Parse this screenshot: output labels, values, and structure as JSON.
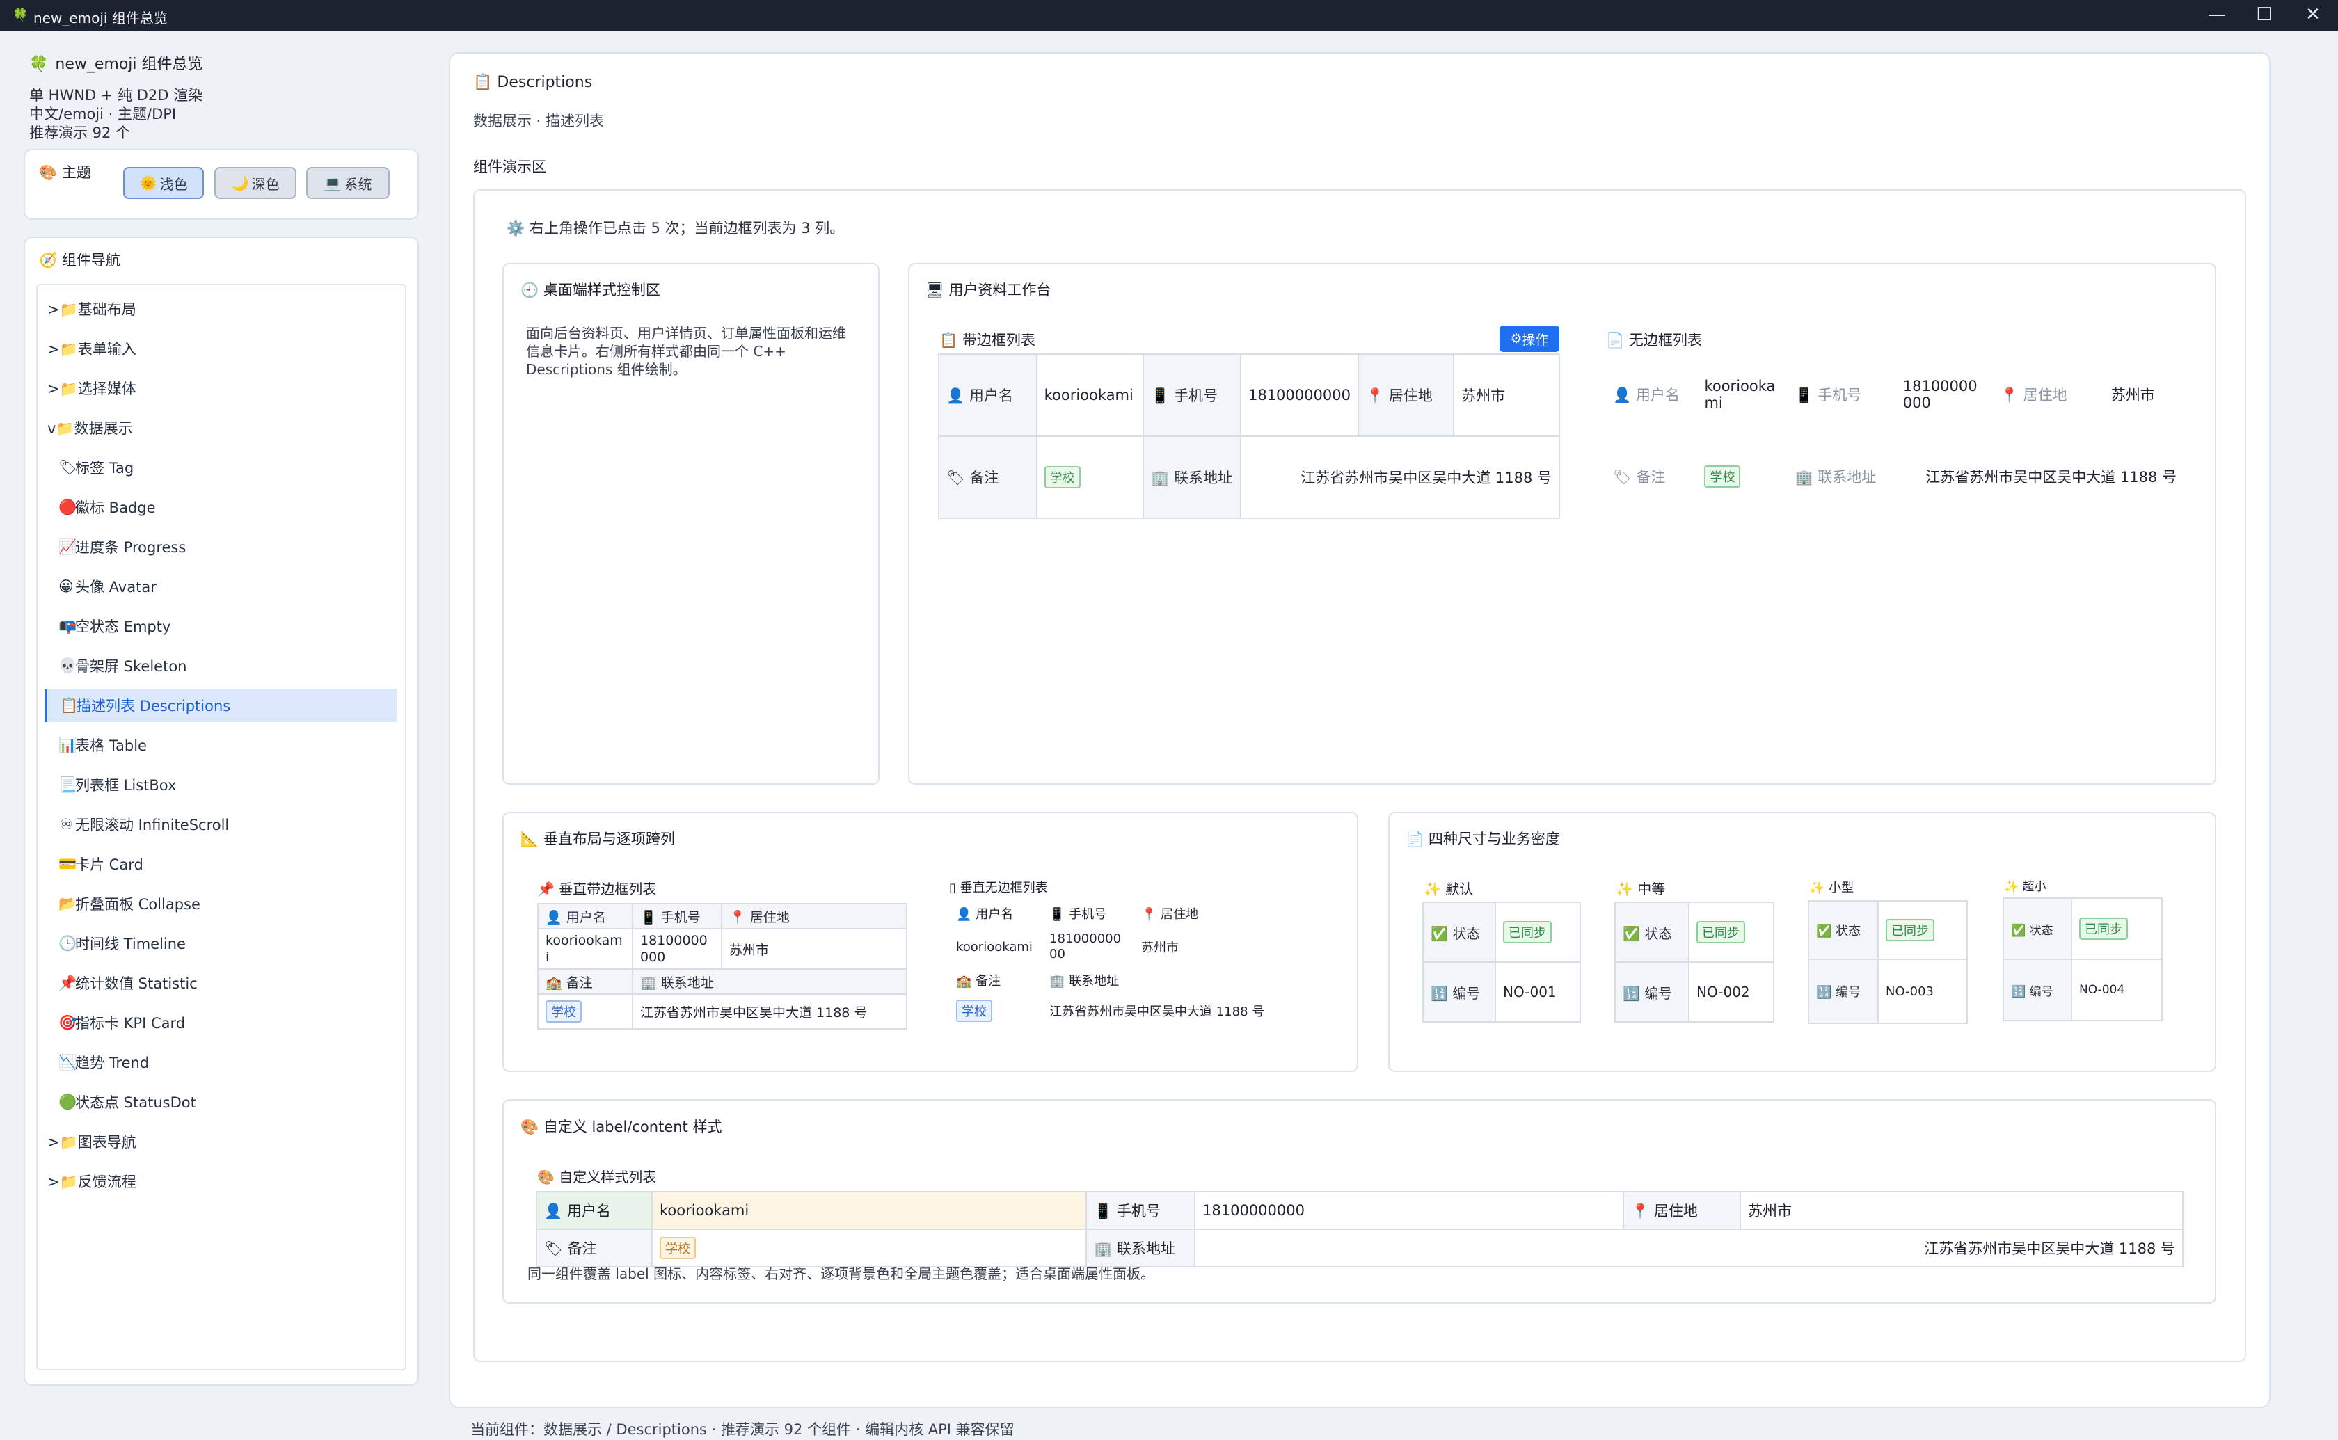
{
  "window": {
    "title": "new_emoji 组件总览",
    "icon": "clover-icon",
    "controls": {
      "minimize": "—",
      "maximize": "☐",
      "close": "✕"
    }
  },
  "sidebar": {
    "app_title": "new_emoji 组件总览",
    "desc_lines": [
      "单 HWND + 纯 D2D 渲染",
      "中文/emoji · 主题/DPI",
      "推荐演示 92 个"
    ],
    "theme": {
      "title": "主题",
      "buttons": [
        "浅色",
        "深色",
        "系统"
      ],
      "selected": "浅色"
    },
    "nav": {
      "title": "组件导航",
      "groups": [
        {
          "label": ">📁基础布局"
        },
        {
          "label": ">📁表单输入"
        },
        {
          "label": ">📁选择媒体"
        },
        {
          "label": "v📁数据展示"
        }
      ],
      "children": [
        {
          "icon": "🏷",
          "label": "标签 Tag"
        },
        {
          "icon": "🔴",
          "label": "徽标 Badge"
        },
        {
          "icon": "📈",
          "label": "进度条 Progress"
        },
        {
          "icon": "😀",
          "label": "头像 Avatar"
        },
        {
          "icon": "📭",
          "label": "空状态 Empty"
        },
        {
          "icon": "💀",
          "label": "骨架屏 Skeleton"
        },
        {
          "icon": "📋",
          "label": "描述列表 Descriptions"
        },
        {
          "icon": "📊",
          "label": "表格 Table"
        },
        {
          "icon": "📃",
          "label": "列表框 ListBox"
        },
        {
          "icon": "♾",
          "label": "无限滚动 InfiniteScroll"
        },
        {
          "icon": "💳",
          "label": "卡片 Card"
        },
        {
          "icon": "📂",
          "label": "折叠面板 Collapse"
        },
        {
          "icon": "🕒",
          "label": "时间线 Timeline"
        },
        {
          "icon": "📌",
          "label": "统计数值 Statistic"
        },
        {
          "icon": "🎯",
          "label": "指标卡 KPI Card"
        },
        {
          "icon": "📉",
          "label": "趋势 Trend"
        },
        {
          "icon": "🟢",
          "label": "状态点 StatusDot"
        }
      ],
      "tail_groups": [
        {
          "label": ">📁图表导航"
        },
        {
          "label": ">📁反馈流程"
        }
      ],
      "active": "描述列表 Descriptions"
    }
  },
  "main": {
    "title": "Descriptions",
    "subtitle": "数据展示 · 描述列表",
    "demo_label": "组件演示区",
    "status": "右上角操作已点击 5 次；当前边框列表为 3 列。",
    "console": {
      "title": "桌面端样式控制区",
      "text": "面向后台资料页、用户详情页、订单属性面板和运维信息卡片。右侧所有样式都由同一个 C++ Descriptions 组件绘制。"
    },
    "workbench": {
      "title": "用户资料工作台",
      "bordered_title": "带边框列表",
      "borderless_title": "无边框列表",
      "op_button": "操作"
    },
    "fields": {
      "username_label": "用户名",
      "username": "kooriookami",
      "phone_label": "手机号",
      "phone": "18100000000",
      "city_label": "居住地",
      "city": "苏州市",
      "remark_label": "备注",
      "remark": "学校",
      "address_label": "联系地址",
      "address": "江苏省苏州市吴中区吴中大道 1188 号"
    },
    "vertical": {
      "title": "垂直布局与逐项跨列",
      "bordered_title": "垂直带边框列表",
      "borderless_title": "垂直无边框列表"
    },
    "sizes": {
      "title": "四种尺寸与业务密度",
      "status_label": "状态",
      "status_value": "已同步",
      "id_label": "编号",
      "items": [
        {
          "name": "默认",
          "id": "NO-001"
        },
        {
          "name": "中等",
          "id": "NO-002"
        },
        {
          "name": "小型",
          "id": "NO-003"
        },
        {
          "name": "超小",
          "id": "NO-004"
        }
      ]
    },
    "custom": {
      "title": "自定义 label/content 样式",
      "list_title": "自定义样式列表",
      "note": "同一组件覆盖 label 图标、内容标签、右对齐、逐项背景色和全局主题色覆盖；适合桌面端属性面板。"
    }
  },
  "footer": "当前组件：数据展示 / Descriptions · 推荐演示 92 个组件 · 编辑内核 API 兼容保留"
}
